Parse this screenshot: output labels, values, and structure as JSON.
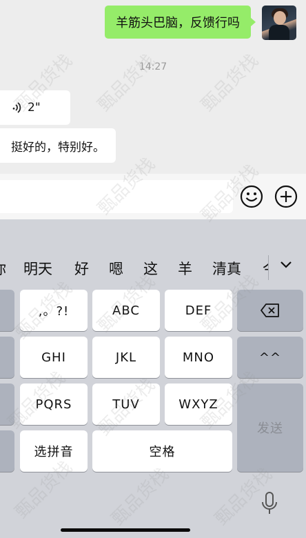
{
  "chat": {
    "outgoing_text": "羊筋头巴脑，反馈行吗",
    "timestamp": "14:27",
    "voice_duration": "2\"",
    "incoming_text": "挺好的，特别好。"
  },
  "input_bar": {
    "emoji_icon": "smiley-icon",
    "plus_icon": "plus-circle-icon"
  },
  "keyboard": {
    "candidates": [
      "你",
      "明天",
      "好",
      "嗯",
      "这",
      "羊",
      "清真",
      "今"
    ],
    "keys": {
      "punct": ",。?!",
      "abc": "ABC",
      "def": "DEF",
      "ghi": "GHI",
      "jkl": "JKL",
      "mno": "MNO",
      "emoticon": "^^",
      "pqrs": "PQRS",
      "tuv": "TUV",
      "wxyz": "WXYZ",
      "send": "发送",
      "pinyin": "选拼音",
      "space": "空格"
    }
  },
  "watermark": "甄品货栈",
  "colors": {
    "outgoing_bubble": "#95ec69",
    "chat_bg": "#ededed",
    "keyboard_bg": "#d1d3d9"
  }
}
